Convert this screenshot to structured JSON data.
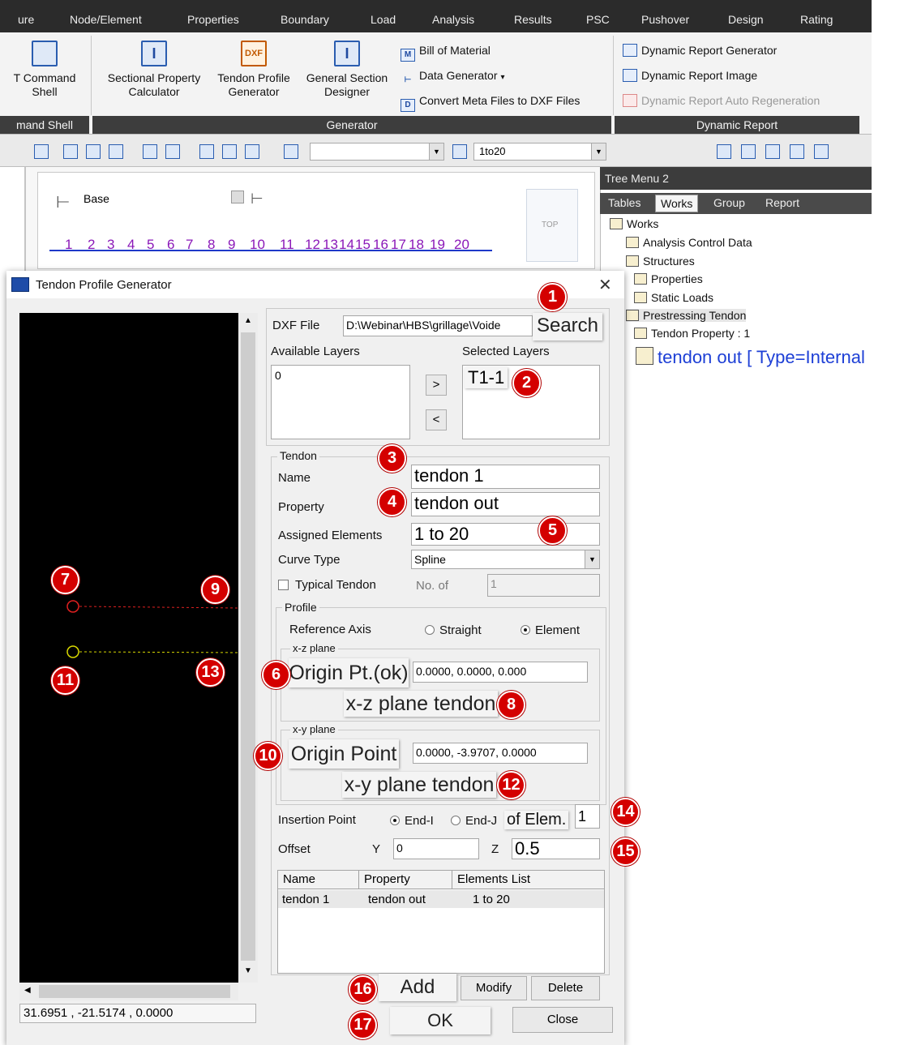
{
  "menubar": {
    "items": [
      "ure",
      "Node/Element",
      "Properties",
      "Boundary",
      "Load",
      "Analysis",
      "Results",
      "PSC",
      "Pushover",
      "Design",
      "Rating"
    ]
  },
  "ribbon": {
    "command_shell": {
      "line1": "T Command",
      "line2": "Shell"
    },
    "command_shell_group": "mand Shell",
    "sectional_property": {
      "line1": "Sectional Property",
      "line2": "Calculator"
    },
    "tendon_profile": {
      "line1": "Tendon Profile",
      "line2": "Generator",
      "icon_text": "DXF"
    },
    "general_section": {
      "line1": "General Section",
      "line2": "Designer"
    },
    "bill_of_material": "Bill of Material",
    "data_generator": "Data Generator",
    "convert_meta": "Convert Meta Files to DXF Files",
    "generator_group": "Generator",
    "dynamic_report_generator": "Dynamic Report Generator",
    "dynamic_report_image": "Dynamic Report Image",
    "dynamic_report_auto": "Dynamic Report Auto Regeneration",
    "dynamic_report_group": "Dynamic Report"
  },
  "toolbar": {
    "combo_value": "1to20"
  },
  "model_view": {
    "base_label": "Base",
    "nav_top": "TOP",
    "nodes": [
      "1",
      "2",
      "3",
      "4",
      "5",
      "6",
      "7",
      "8",
      "9",
      "10",
      "11",
      "12",
      "13",
      "14",
      "15",
      "16",
      "17",
      "18",
      "19",
      "20"
    ]
  },
  "tree": {
    "title": "Tree Menu 2",
    "tabs": [
      "Tables",
      "Works",
      "Group",
      "Report"
    ],
    "items": [
      "Works",
      "Analysis Control Data",
      "Structures",
      "Properties",
      "Static Loads",
      "Prestressing Tendon",
      "Tendon Property : 1"
    ],
    "tendon_out": "tendon out [ Type=Internal"
  },
  "dialog": {
    "title": "Tendon Profile Generator",
    "coord": "31.6951 , -21.5174 , 0.0000",
    "dxf_label": "DXF File",
    "dxf_path": "D:\\Webinar\\HBS\\grillage\\Voide",
    "search": "Search",
    "available_layers": "Available Layers",
    "selected_layers": "Selected Layers",
    "available": [
      "0"
    ],
    "selected": [
      "T1-1"
    ],
    "move_right": ">",
    "move_left": "<",
    "tendon_group": "Tendon",
    "name_label": "Name",
    "name_value": "tendon 1",
    "property_label": "Property",
    "property_value": "tendon out",
    "assigned_label": "Assigned Elements",
    "assigned_value": "1 to 20",
    "curve_label": "Curve Type",
    "curve_value": "Spline",
    "typical_label": "Typical Tendon",
    "no_of_label": "No. of",
    "no_of_value": "1",
    "profile_group": "Profile",
    "ref_axis_label": "Reference Axis",
    "straight": "Straight",
    "element": "Element",
    "xz_group": "x-z plane",
    "xz_origin_btn": "Origin Pt.(ok)",
    "xz_origin_value": "0.0000, 0.0000, 0.000",
    "xz_tendon_btn": "x-z plane tendon",
    "xy_group": "x-y plane",
    "xy_origin_btn": "Origin Point",
    "xy_origin_value": "0.0000, -3.9707, 0.0000",
    "xy_tendon_btn": "x-y plane tendon",
    "insertion_label": "Insertion Point",
    "end_i": "End-I",
    "end_j": "End-J",
    "of_elem": "of Elem.",
    "elem_value": "1",
    "offset_label": "Offset",
    "y_label": "Y",
    "y_value": "0",
    "z_label": "Z",
    "z_value": "0.5",
    "table_headers": [
      "Name",
      "Property",
      "Elements List"
    ],
    "table_rows": [
      {
        "name": "tendon 1",
        "property": "tendon out",
        "elements": "1 to 20"
      }
    ],
    "add": "Add",
    "modify": "Modify",
    "delete": "Delete",
    "ok": "OK",
    "close": "Close"
  },
  "badges": [
    "1",
    "2",
    "3",
    "4",
    "5",
    "6",
    "7",
    "8",
    "9",
    "10",
    "11",
    "12",
    "13",
    "14",
    "15",
    "16",
    "17"
  ],
  "colors": {
    "badge": "#d40000",
    "tendon_red": "#e02020",
    "tendon_yellow": "#d8d800",
    "node_purple": "#8a17b8",
    "tree_link": "#1d3fd6"
  }
}
